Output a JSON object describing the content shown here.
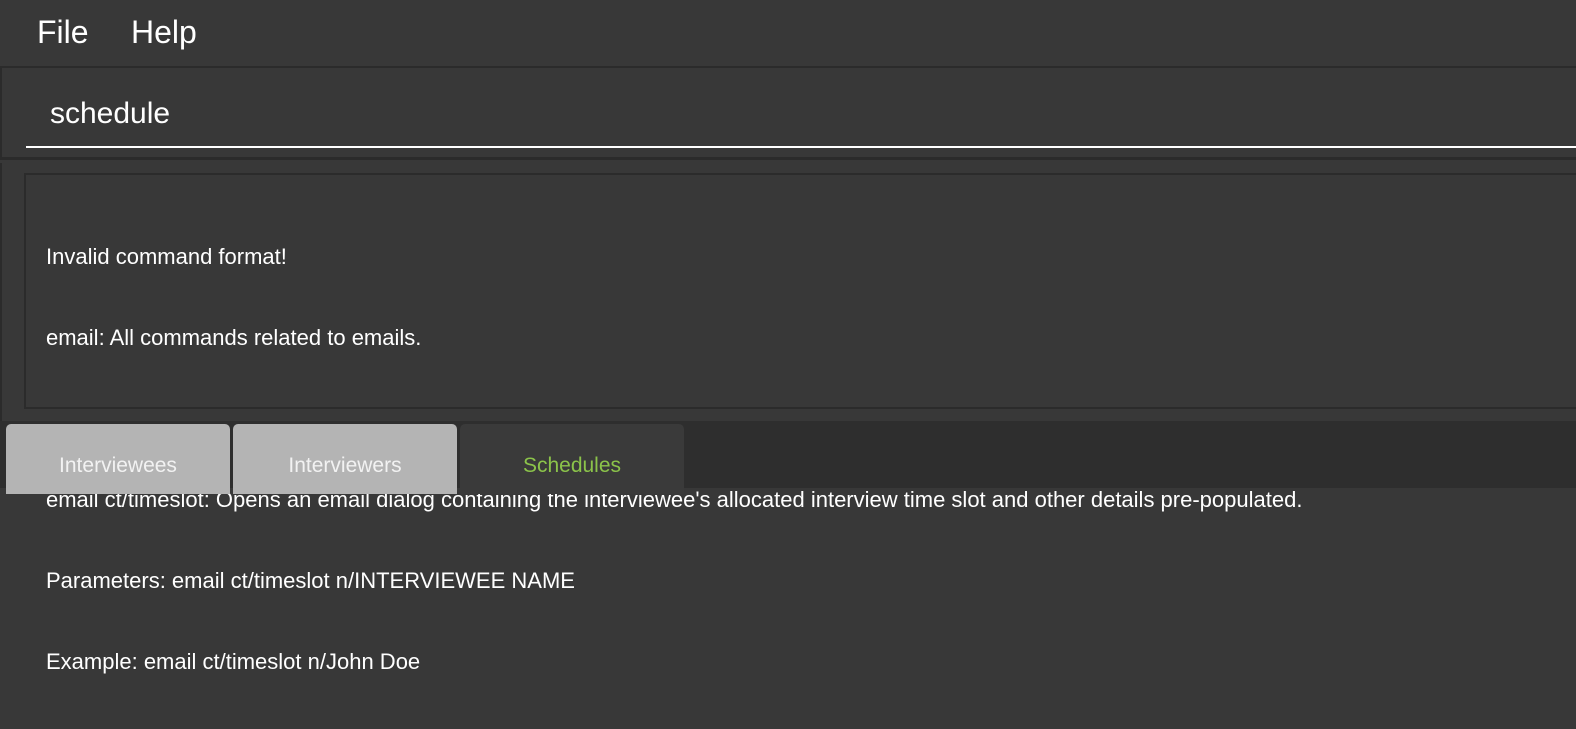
{
  "menu": {
    "items": [
      {
        "label": "File"
      },
      {
        "label": "Help"
      }
    ]
  },
  "command_box": {
    "value": "schedule"
  },
  "result_display": {
    "lines": [
      "Invalid command format!",
      "email: All commands related to emails.",
      "",
      "email ct/timeslot: Opens an email dialog containing the interviewee's allocated interview time slot and other details pre-populated.",
      "Parameters: email ct/timeslot n/INTERVIEWEE NAME",
      "Example: email ct/timeslot n/John Doe"
    ]
  },
  "tabs": [
    {
      "label": "Interviewees",
      "active": false
    },
    {
      "label": "Interviewers",
      "active": false
    },
    {
      "label": "Schedules",
      "active": true
    }
  ],
  "colors": {
    "accent": "#8bc34a",
    "background": "#383838",
    "tab_inactive": "#b4b4b4"
  }
}
